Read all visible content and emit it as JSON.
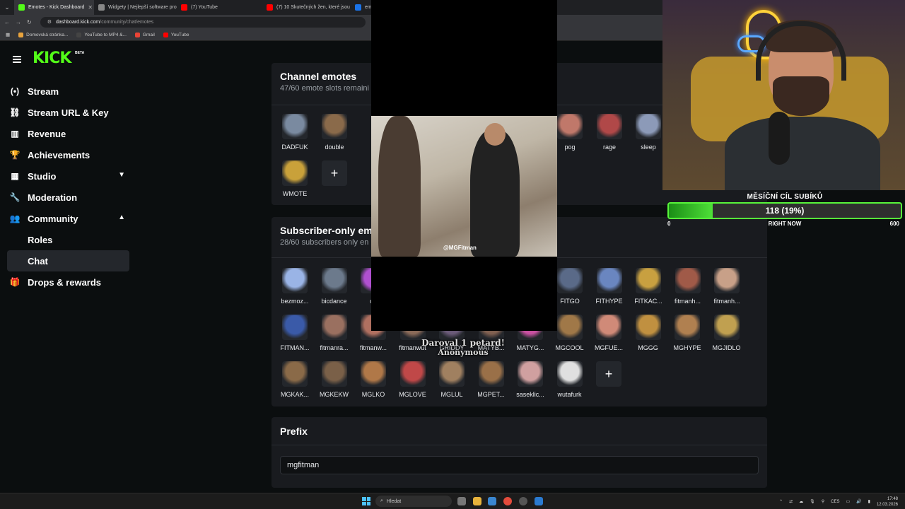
{
  "browser": {
    "tabs": [
      {
        "title": "Emotes - Kick Dashboard",
        "color": "#53fc18",
        "active": true
      },
      {
        "title": "Widgety | Nejlepší software pro",
        "color": "#888888",
        "active": false
      },
      {
        "title": "(7) YouTube",
        "color": "#ff0000",
        "active": false
      },
      {
        "title": "(7) 10 Skutečných žen, které jsou",
        "color": "#ff0000",
        "active": false
      },
      {
        "title": "emo",
        "color": "#1a73e8",
        "active": false
      }
    ],
    "url_host": "dashboard.kick.com",
    "url_path": "/community/chat/emotes",
    "bookmarks": [
      {
        "label": "Domovská stránka...",
        "color": "#e8a33d"
      },
      {
        "label": "YouTube to MP4 &...",
        "color": "#444444"
      },
      {
        "label": "Gmail",
        "color": "#ea4335"
      },
      {
        "label": "YouTube",
        "color": "#ff0000"
      }
    ]
  },
  "header": {
    "logo": "KICK",
    "beta": "BETA"
  },
  "nav": {
    "items": [
      {
        "label": "Stream",
        "icon": "(•)"
      },
      {
        "label": "Stream URL & Key",
        "icon": "⛓"
      },
      {
        "label": "Revenue",
        "icon": "▥"
      },
      {
        "label": "Achievements",
        "icon": "🏆"
      },
      {
        "label": "Studio",
        "icon": "▦"
      },
      {
        "label": "Moderation",
        "icon": "🔧"
      },
      {
        "label": "Community",
        "icon": "👥"
      }
    ],
    "sub_items": [
      {
        "label": "Roles"
      },
      {
        "label": "Chat"
      }
    ],
    "drops": {
      "label": "Drops & rewards",
      "icon": "🎁"
    }
  },
  "channel_emotes": {
    "title": "Channel emotes",
    "subtitle": "47/60 emote slots remaini",
    "row1": [
      {
        "label": "DADFUK",
        "color": "#7a8aa0"
      },
      {
        "label": "double",
        "color": "#8a6a4a"
      },
      {
        "label": "pog",
        "color": "#c0786a"
      },
      {
        "label": "rage",
        "color": "#b04848"
      },
      {
        "label": "sleep",
        "color": "#8c9ab8"
      }
    ],
    "row2": [
      {
        "label": "WMOTE",
        "color": "#c9a13a"
      }
    ]
  },
  "subscriber_emotes": {
    "title": "Subscriber-only em",
    "subtitle": "28/60 subscribers only en",
    "row1_left": [
      {
        "label": "bezmoz...",
        "color": "#9ab4e6"
      },
      {
        "label": "bicdance",
        "color": "#6c7a8c"
      },
      {
        "label": "ca",
        "color": "#b050d0"
      }
    ],
    "row1_right": [
      {
        "label": "FITGO",
        "color": "#5a6a88"
      },
      {
        "label": "FITHYPE",
        "color": "#6a86c0"
      },
      {
        "label": "FITKAC...",
        "color": "#c8a040"
      },
      {
        "label": "fitmanh...",
        "color": "#a05a48"
      },
      {
        "label": "fitmanh...",
        "color": "#c8a088"
      }
    ],
    "row2": [
      {
        "label": "FITMAN...",
        "color": "#3a5aa8"
      },
      {
        "label": "fitmanra...",
        "color": "#9a7060"
      },
      {
        "label": "fitmanw...",
        "color": "#b07060"
      },
      {
        "label": "fitmanwut",
        "color": "#8a6a58"
      },
      {
        "label": "GRIDDY",
        "color": "#6a5a78"
      },
      {
        "label": "MATYB...",
        "color": "#806050"
      },
      {
        "label": "MATYG...",
        "color": "#c850a0"
      },
      {
        "label": "MGCOOL",
        "color": "#a07848"
      },
      {
        "label": "MGFUE...",
        "color": "#d08a78"
      },
      {
        "label": "MGGG",
        "color": "#c09040"
      },
      {
        "label": "MGHYPE",
        "color": "#b08050"
      },
      {
        "label": "MGJIDLO",
        "color": "#c0a050"
      }
    ],
    "row3": [
      {
        "label": "MGKAK...",
        "color": "#8a6a48"
      },
      {
        "label": "MGKEKW",
        "color": "#7a6048"
      },
      {
        "label": "MGLKO",
        "color": "#b07848"
      },
      {
        "label": "MGLOVE",
        "color": "#c04848"
      },
      {
        "label": "MGLUL",
        "color": "#a08060"
      },
      {
        "label": "MGPET...",
        "color": "#9a7048"
      },
      {
        "label": "saseklic...",
        "color": "#d0a0a0"
      },
      {
        "label": "wutafurk",
        "color": "#e0e0e0"
      }
    ]
  },
  "prefix": {
    "title": "Prefix",
    "value": "mgfitman"
  },
  "video": {
    "tag": "@MGFitman"
  },
  "donation": {
    "line1": "Daroval 1 petard!",
    "line2": "Anonymous"
  },
  "goal": {
    "title": "MĚSÍČNÍ CÍL SUBÍKŮ",
    "current": 118,
    "max": 600,
    "percent": 19,
    "label": "118 (19%)",
    "min_label": "0",
    "mid_label": "RIGHT NOW",
    "max_label": "600"
  },
  "taskbar": {
    "search": "Hledat",
    "lang": "CES",
    "time": "17:48",
    "date": "12.03.2026"
  },
  "colors": {
    "accent": "#53fc18",
    "bg": "#0b0e0f",
    "card": "#191b1f"
  }
}
